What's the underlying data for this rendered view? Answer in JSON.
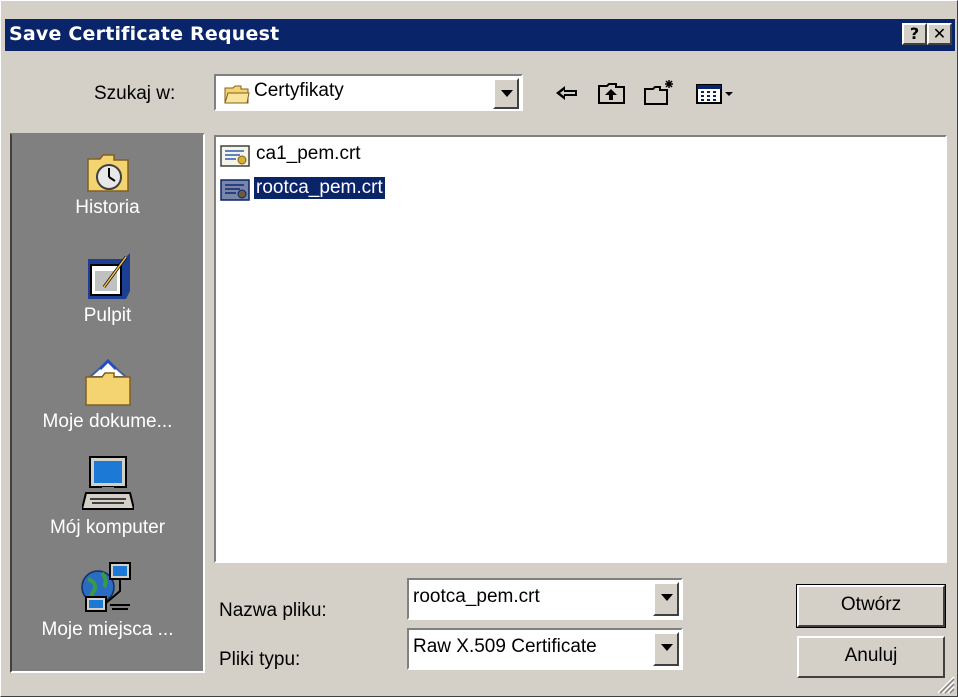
{
  "window": {
    "title": "Save Certificate Request",
    "help_label": "?",
    "close_label": "✕"
  },
  "lookin": {
    "label": "Szukaj w:",
    "value": "Certyfikaty",
    "icon": "folder-icon"
  },
  "toolbar": {
    "back_icon": "back-arrow-icon",
    "up_icon": "up-folder-icon",
    "newfolder_icon": "new-folder-icon",
    "views_icon": "views-menu-icon"
  },
  "places": [
    {
      "label": "Historia",
      "icon": "history-icon"
    },
    {
      "label": "Pulpit",
      "icon": "desktop-icon"
    },
    {
      "label": "Moje dokume...",
      "icon": "my-documents-icon"
    },
    {
      "label": "Mój komputer",
      "icon": "my-computer-icon"
    },
    {
      "label": "Moje miejsca ...",
      "icon": "network-places-icon"
    }
  ],
  "files": [
    {
      "name": "ca1_pem.crt",
      "selected": false,
      "icon": "certificate-icon"
    },
    {
      "name": "rootca_pem.crt",
      "selected": true,
      "icon": "certificate-icon"
    }
  ],
  "filename": {
    "label": "Nazwa pliku:",
    "value": "rootca_pem.crt"
  },
  "filetype": {
    "label": "Pliki typu:",
    "value": "Raw X.509 Certificate"
  },
  "buttons": {
    "open": "Otwórz",
    "cancel": "Anuluj"
  },
  "colors": {
    "titlebar": "#0a246a",
    "face": "#d4d0c8",
    "places_bg": "#808080",
    "selection": "#0a246a"
  }
}
